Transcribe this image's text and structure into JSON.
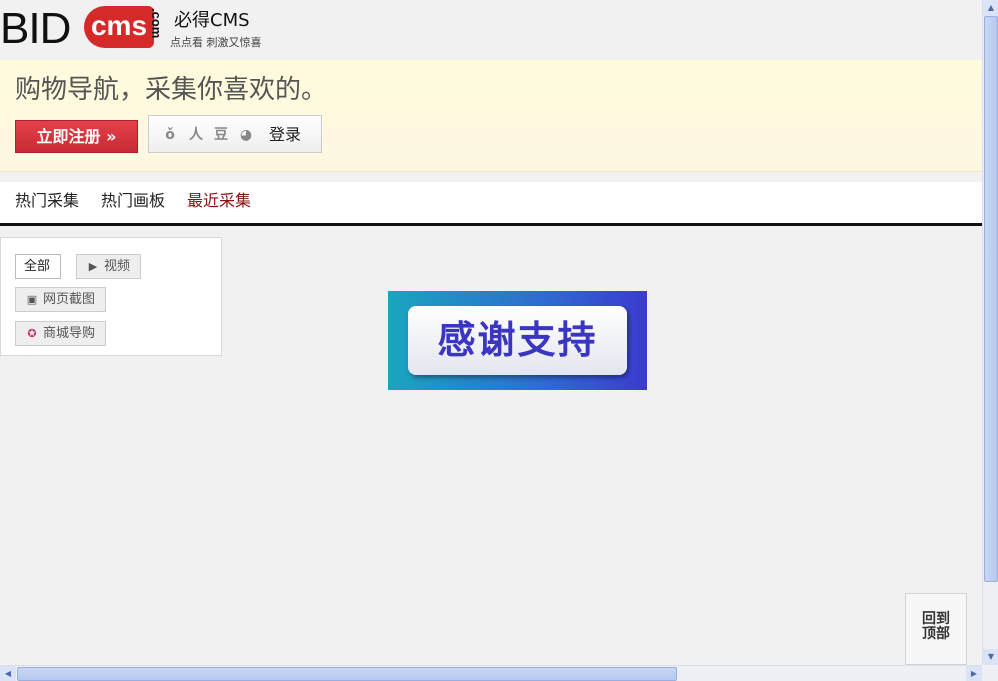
{
  "header": {
    "logo_text": "BIDcms.com",
    "logo_part1": "BID",
    "logo_part2": "cms",
    "logo_part3": ".com",
    "site_title": "必得CMS",
    "slogan": "点点看  刺激又惊喜"
  },
  "banner": {
    "headline": "购物导航，采集你喜欢的。",
    "register_label": "立即注册 »",
    "login_label": "登录",
    "social_icons": [
      "weibo-icon",
      "renren-icon",
      "douban-icon",
      "qq-icon"
    ],
    "social_glyphs": [
      "ǒ",
      "人",
      "豆",
      "◕"
    ]
  },
  "nav": {
    "items": [
      "热门采集",
      "热门画板",
      "最近采集"
    ],
    "active_index": 2
  },
  "filters": {
    "items": [
      {
        "label": "全部",
        "selected": true,
        "icon": ""
      },
      {
        "label": "视频",
        "selected": false,
        "icon": "video-icon"
      },
      {
        "label": "网页截图",
        "selected": false,
        "icon": "camera-icon"
      },
      {
        "label": "商城导购",
        "selected": false,
        "icon": "star-icon"
      }
    ]
  },
  "promo": {
    "text": "感谢支持"
  },
  "back_to_top": {
    "line1": "回到",
    "line2": "顶部"
  },
  "colors": {
    "accent_red": "#d62a2a",
    "nav_active": "#8b1010",
    "banner_bg": "#fffbdc",
    "promo_text": "#3a36c2"
  }
}
